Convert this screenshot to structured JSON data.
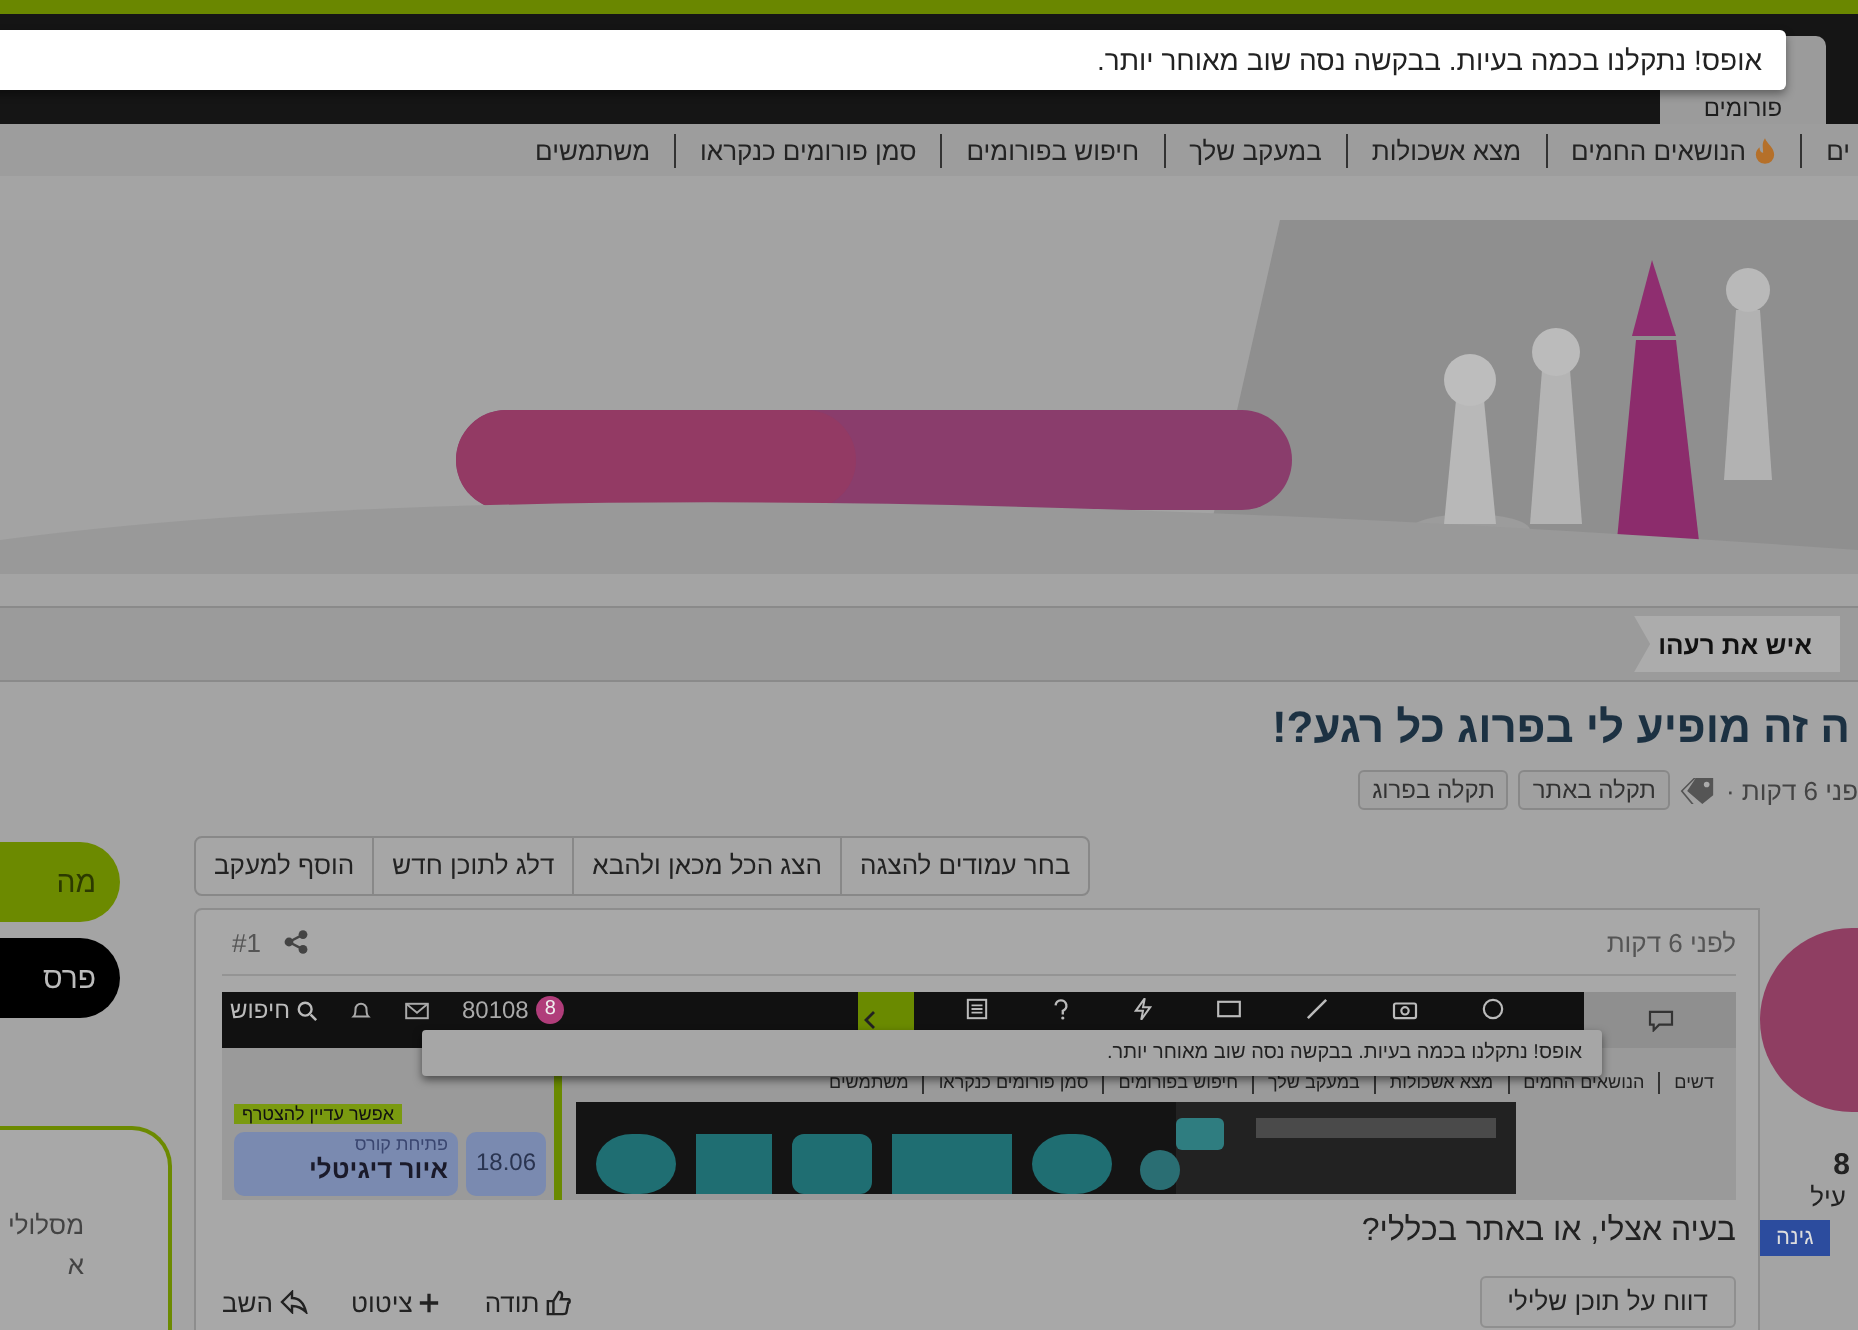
{
  "top_nav": {
    "tabs": [
      {
        "label": "פורומים",
        "selected": true
      }
    ]
  },
  "toast": {
    "message": "אופס! נתקלנו בכמה בעיות. בבקשה נסה שוב מאוחר יותר."
  },
  "sub_nav": {
    "items": [
      {
        "label": "ים",
        "kind": "plain"
      },
      {
        "label": "הנושאים החמים",
        "kind": "hot"
      },
      {
        "label": "מצא אשכולות",
        "kind": "plain"
      },
      {
        "label": "במעקב שלך",
        "kind": "plain"
      },
      {
        "label": "חיפוש בפורומים",
        "kind": "plain"
      },
      {
        "label": "סמן פורומים כנקראו",
        "kind": "plain"
      },
      {
        "label": "משתמשים",
        "kind": "plain"
      }
    ]
  },
  "banner": {
    "kind": "picture"
  },
  "breadcrumb": [
    "איש את רעהו"
  ],
  "thread": {
    "title": "ה זה מופיע לי בפרוג כל רגע?!",
    "meta": "פני 6 דקות ·",
    "tags": [
      "תקלה באתר",
      "תקלה בפרוג"
    ]
  },
  "thread_actions": [
    "בחר עמודים להצגה",
    "הצג הכל מכאן ולהבא",
    "דלג לתוכן חדש",
    "הוסף למעקב"
  ],
  "sidebar": {
    "buttons": [
      {
        "label": "מה",
        "kind": "green"
      },
      {
        "label": "פרס",
        "kind": "black"
      }
    ],
    "card_lines": [
      "מסלולי",
      "א"
    ]
  },
  "post": {
    "time": "לפני 6 דקות",
    "number": "#1",
    "user": {
      "count": "8",
      "name": "עיל",
      "badge": "גינה"
    },
    "screenshot": {
      "toast": "אופס! נתקלנו בכמה בעיות. בבקשה נסה שוב מאוחר יותר.",
      "counter": "80108",
      "alerts": "8",
      "search": "חיפוש",
      "sub_nav": [
        "דשים",
        "הנושאים החמים",
        "מצא אשכולות",
        "במעקב שלך",
        "חיפוש בפורומים",
        "סמן פורומים כנקראו",
        "משתמשים"
      ],
      "join_tag": "אפשר עדיין להצטרף",
      "date": "18.06",
      "course_tag": "פתיחת קורס",
      "course_title": "איור דיגיטלי"
    },
    "body": "בעיה אצלי, או באתר בכללי?",
    "report": "דווח על תוכן שלילי",
    "actions": [
      {
        "label": "תודה",
        "kind": "like"
      },
      {
        "label": "ציטוט",
        "kind": "quote"
      },
      {
        "label": "השב",
        "kind": "reply"
      }
    ]
  }
}
